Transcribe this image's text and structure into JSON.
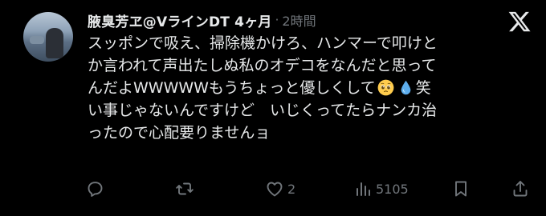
{
  "post": {
    "display_name": "腋臭芳ヱ@VラインDT 4ヶ月",
    "separator": "·",
    "time_ago": "2時間",
    "body_lines": [
      "スッポンで吸え、掃除機かけろ、ハンマーで叩けと",
      "か言われて声出たしぬ私のオデコをなんだと思って",
      "んだよWWWWWもうちょっと優しくして",
      "い事じゃないんですけど　いじくってたらナンカ治",
      "ったので心配要りませんョ"
    ],
    "line3_after_emoji": "笑",
    "emojis": [
      "pleading-face-emoji",
      "droplet-emoji"
    ]
  },
  "actions": {
    "reply_count": "",
    "repost_count": "",
    "like_count": "2",
    "view_count": "5105"
  },
  "colors": {
    "background": "#000000",
    "text": "#e7e9ea",
    "muted": "#71767b"
  }
}
